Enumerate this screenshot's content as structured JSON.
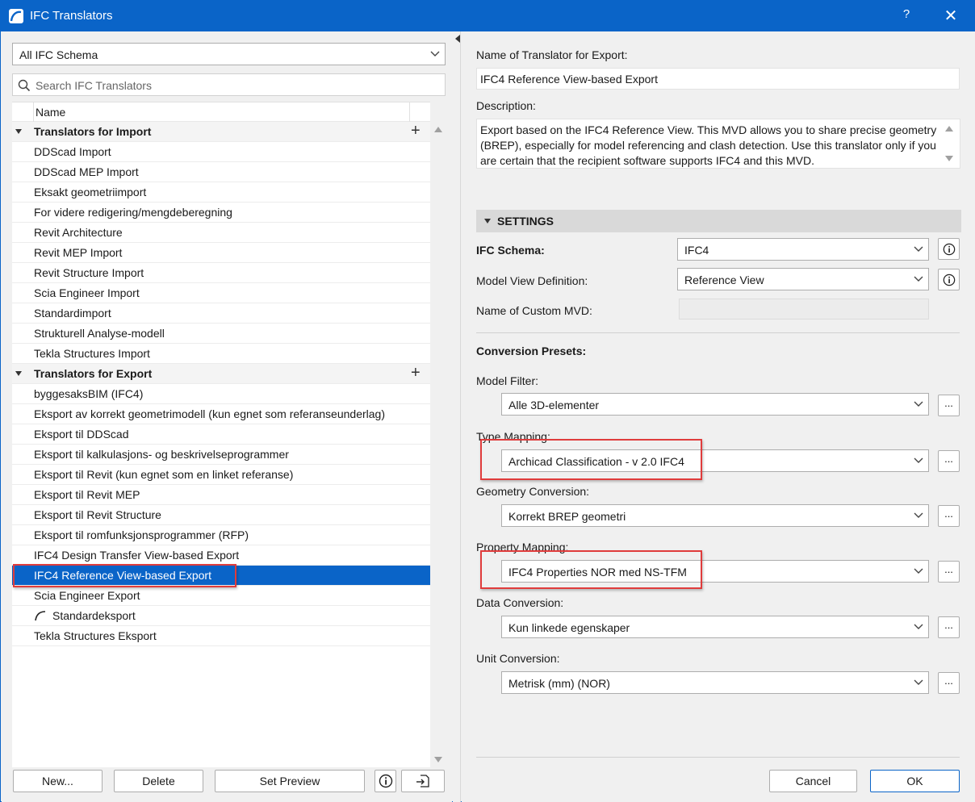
{
  "window": {
    "title": "IFC Translators",
    "help": "?",
    "close": "✕"
  },
  "left": {
    "schema_filter": "All IFC Schema",
    "search_placeholder": "Search IFC Translators",
    "column_name": "Name",
    "groups": [
      {
        "label": "Translators for Import",
        "items": [
          "DDScad Import",
          "DDScad MEP Import",
          "Eksakt geometriimport",
          "For videre redigering/mengdeberegning",
          "Revit Architecture",
          "Revit MEP Import",
          "Revit Structure Import",
          "Scia Engineer Import",
          "Standardimport",
          "Strukturell Analyse-modell",
          "Tekla Structures Import"
        ]
      },
      {
        "label": "Translators for Export",
        "items": [
          "byggesaksBIM (IFC4)",
          "Eksport av korrekt geometrimodell (kun egnet som referanseunderlag)",
          "Eksport til DDScad",
          "Eksport til kalkulasjons- og beskrivelseprogrammer",
          "Eksport til Revit (kun egnet som en linket referanse)",
          "Eksport til Revit MEP",
          "Eksport til Revit Structure",
          "Eksport til romfunksjonsprogrammer (RFP)",
          "IFC4 Design Transfer View-based Export",
          "IFC4 Reference View-based Export",
          "Scia Engineer Export",
          "Standardeksport",
          "Tekla Structures Eksport"
        ]
      }
    ],
    "selected_item": "IFC4 Reference View-based Export",
    "buttons": {
      "new": "New...",
      "delete": "Delete",
      "preview": "Set Preview"
    }
  },
  "right": {
    "name_label": "Name of Translator for Export:",
    "name_value": "IFC4 Reference View-based Export",
    "desc_label": "Description:",
    "desc_value": "Export based on the IFC4 Reference View. This MVD allows you to share precise geometry (BREP), especially for model referencing and clash detection. Use this translator only if you are certain that the recipient software supports IFC4 and this MVD.",
    "settings_title": "SETTINGS",
    "schema_label": "IFC Schema:",
    "schema_value": "IFC4",
    "mvd_label": "Model View Definition:",
    "mvd_value": "Reference View",
    "custom_mvd_label": "Name of Custom MVD:",
    "presets_title": "Conversion Presets:",
    "model_filter_label": "Model Filter:",
    "model_filter_value": "Alle 3D-elementer",
    "type_mapping_label": "Type Mapping:",
    "type_mapping_value": "Archicad Classification - v 2.0 IFC4",
    "geometry_label": "Geometry Conversion:",
    "geometry_value": "Korrekt BREP geometri",
    "property_label": "Property Mapping:",
    "property_value": "IFC4 Properties NOR med NS-TFM",
    "data_label": "Data Conversion:",
    "data_value": "Kun linkede egenskaper",
    "unit_label": "Unit Conversion:",
    "unit_value": "Metrisk (mm) (NOR)",
    "dots": "...",
    "cancel": "Cancel",
    "ok": "OK"
  },
  "colors": {
    "accent": "#0a64c8",
    "highlight": "#e03c3c"
  }
}
